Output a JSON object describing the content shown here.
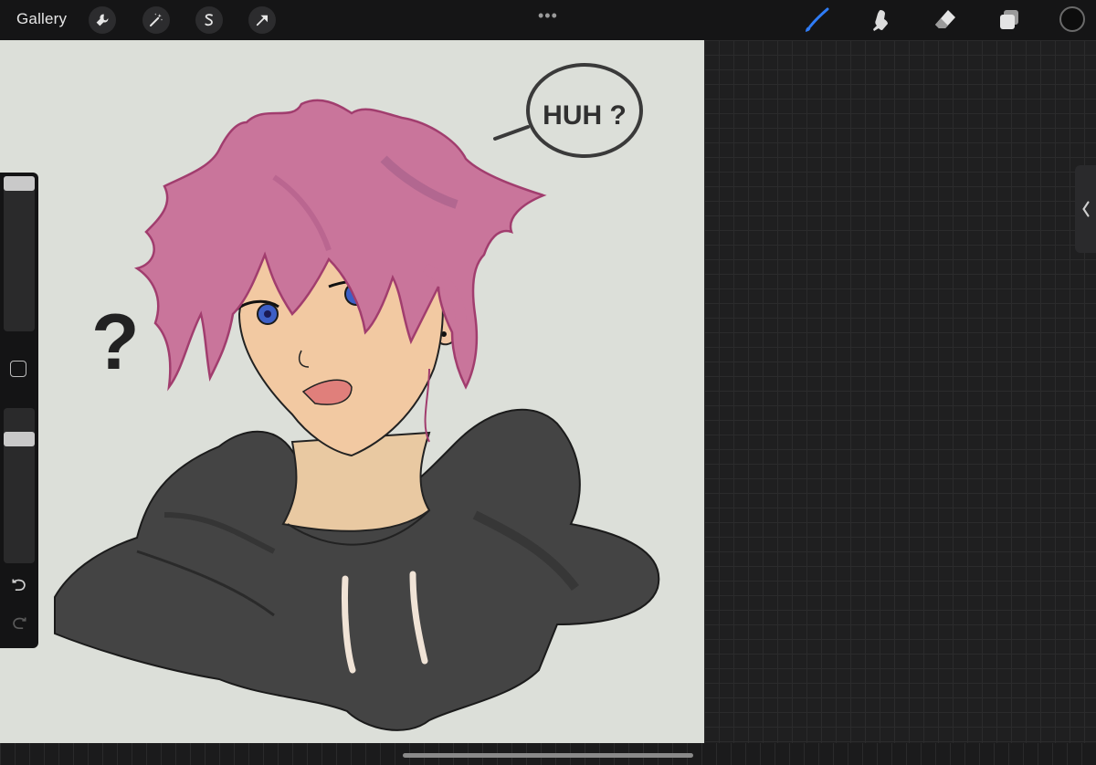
{
  "topbar": {
    "gallery_label": "Gallery",
    "left_tools": [
      "wrench-icon",
      "magic-wand-icon",
      "selection-icon",
      "transform-arrow-icon"
    ],
    "more_label": "•••",
    "right_tools": [
      "brush-icon",
      "smudge-icon",
      "eraser-icon",
      "layers-icon"
    ],
    "active_tool": "brush-icon",
    "current_color": "#0d0d0d",
    "accent_color": "#2f7cf6"
  },
  "canvas": {
    "speech_bubble_text": "HUH ?",
    "side_mark": "?"
  },
  "sidebar": {
    "modifier_icon": "square-modifier-icon",
    "undo_icon": "undo-icon",
    "redo_icon": "redo-icon"
  },
  "panel_tab_icon": "chevron-left-icon"
}
